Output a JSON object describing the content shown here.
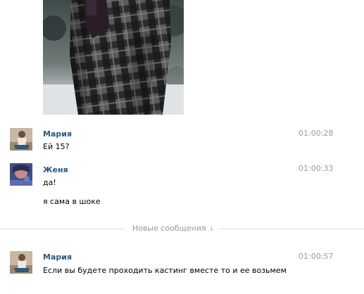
{
  "messages": [
    {
      "author": "Мария",
      "time": "01:00:28",
      "lines": [
        "Ей 15?"
      ]
    },
    {
      "author": "Женя",
      "time": "01:00:33",
      "lines": [
        "да!",
        "я сама в шоке"
      ]
    },
    {
      "author": "Мария",
      "time": "01:00:57",
      "lines": [
        "Если вы будете проходить кастинг вместе то и ее возьмем"
      ]
    }
  ],
  "divider": {
    "label": "Новые сообщения",
    "icon": "arrow-down-icon"
  },
  "colors": {
    "author_link": "#2b587a",
    "timestamp": "#999999",
    "divider_line": "#dae1e8"
  }
}
